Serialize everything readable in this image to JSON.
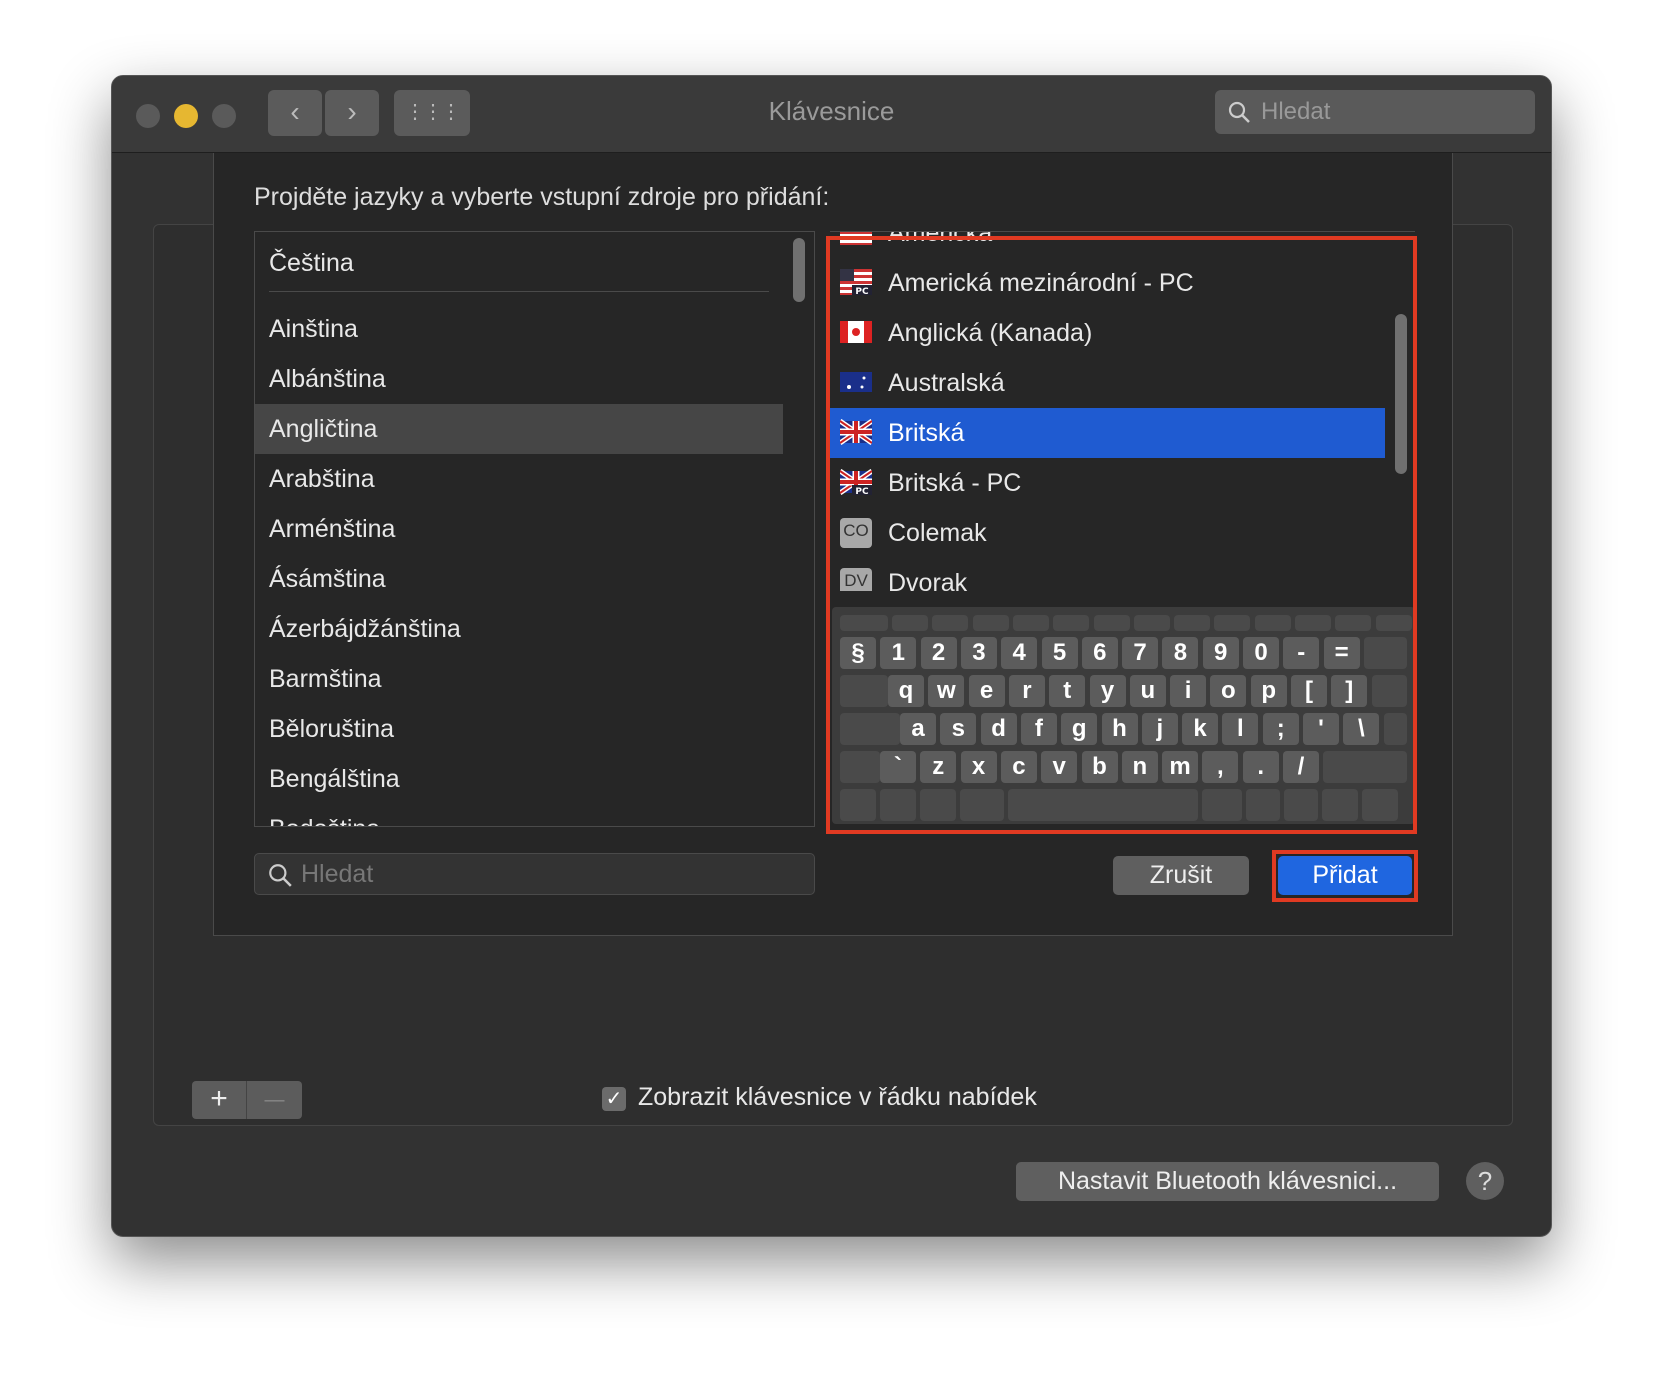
{
  "window": {
    "title": "Klávesnice",
    "search_placeholder": "Hledat",
    "nav_back": "‹",
    "nav_forward": "›",
    "grid": "⋮⋮⋮"
  },
  "sheet": {
    "prompt": "Projděte jazyky a vyberte vstupní zdroje pro přidání:",
    "languages": [
      "Čeština",
      "Ainština",
      "Albánština",
      "Angličtina",
      "Arabština",
      "Arménština",
      "Ásámština",
      "Ázerbájdžánština",
      "Barmština",
      "Běloruština",
      "Bengálština",
      "Bodoština"
    ],
    "selected_language": "Angličtina",
    "sources": [
      {
        "label": "Americká",
        "flag": "us"
      },
      {
        "label": "Americká mezinárodní - PC",
        "flag": "us-pc"
      },
      {
        "label": "Anglická (Kanada)",
        "flag": "ca"
      },
      {
        "label": "Australská",
        "flag": "au"
      },
      {
        "label": "Britská",
        "flag": "gb"
      },
      {
        "label": "Britská - PC",
        "flag": "gb-pc"
      },
      {
        "label": "Colemak",
        "flag": "co"
      },
      {
        "label": "Dvorak",
        "flag": "dv"
      }
    ],
    "selected_source": "Britská",
    "keyboard_rows": [
      [
        "§",
        "1",
        "2",
        "3",
        "4",
        "5",
        "6",
        "7",
        "8",
        "9",
        "0",
        "-",
        "="
      ],
      [
        "q",
        "w",
        "e",
        "r",
        "t",
        "y",
        "u",
        "i",
        "o",
        "p",
        "[",
        "]"
      ],
      [
        "a",
        "s",
        "d",
        "f",
        "g",
        "h",
        "j",
        "k",
        "l",
        ";",
        "'",
        "\\"
      ],
      [
        "`",
        "z",
        "x",
        "c",
        "v",
        "b",
        "n",
        "m",
        ",",
        ".",
        "/"
      ]
    ],
    "search_placeholder": "Hledat",
    "cancel_label": "Zrušit",
    "add_label": "Přidat",
    "highlight_color": "#e03a22",
    "selection_color": "#1f5bd1"
  },
  "footer": {
    "plus": "+",
    "minus": "—",
    "show_in_menu_label": "Zobrazit klávesnice v řádku nabídek",
    "show_in_menu_checked": true,
    "bluetooth_label": "Nastavit Bluetooth klávesnici...",
    "help": "?"
  }
}
